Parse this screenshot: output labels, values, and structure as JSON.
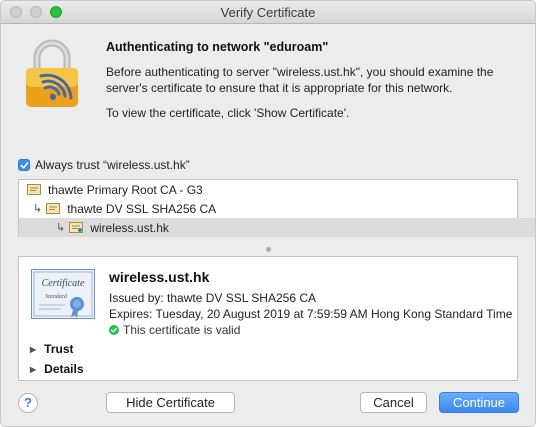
{
  "window": {
    "title": "Verify Certificate"
  },
  "icons": {
    "lock": "lock-wifi-icon",
    "certificate": "certificate-icon",
    "valid": "check-circle-icon"
  },
  "header": {
    "heading": "Authenticating to network \"eduroam\"",
    "message": "Before authenticating to server \"wireless.ust.hk\", you should examine the server's certificate to ensure that it is appropriate for this network.",
    "instruction": "To view the certificate, click 'Show Certificate'."
  },
  "always_trust": {
    "checked": true,
    "label": "Always trust “wireless.ust.hk”"
  },
  "chain": [
    {
      "label": "thawte Primary Root CA - G3",
      "level": 0,
      "selected": false
    },
    {
      "label": "thawte DV SSL SHA256 CA",
      "level": 1,
      "selected": false
    },
    {
      "label": "wireless.ust.hk",
      "level": 2,
      "selected": true
    }
  ],
  "details": {
    "cert_image_text_1": "Certificate",
    "cert_image_text_2": "Standard",
    "name": "wireless.ust.hk",
    "issued_by": "Issued by: thawte DV SSL SHA256 CA",
    "expires": "Expires: Tuesday, 20 August 2019 at 7:59:59 AM Hong Kong Standard Time",
    "status": "This certificate is valid",
    "trust_label": "Trust",
    "details_label": "Details"
  },
  "buttons": {
    "help": "?",
    "hide_certificate": "Hide Certificate",
    "cancel": "Cancel",
    "continue": "Continue"
  },
  "colors": {
    "accent": "#3b88f0",
    "valid": "#2bbd4e",
    "traffic_zoom": "#2bc23f"
  }
}
